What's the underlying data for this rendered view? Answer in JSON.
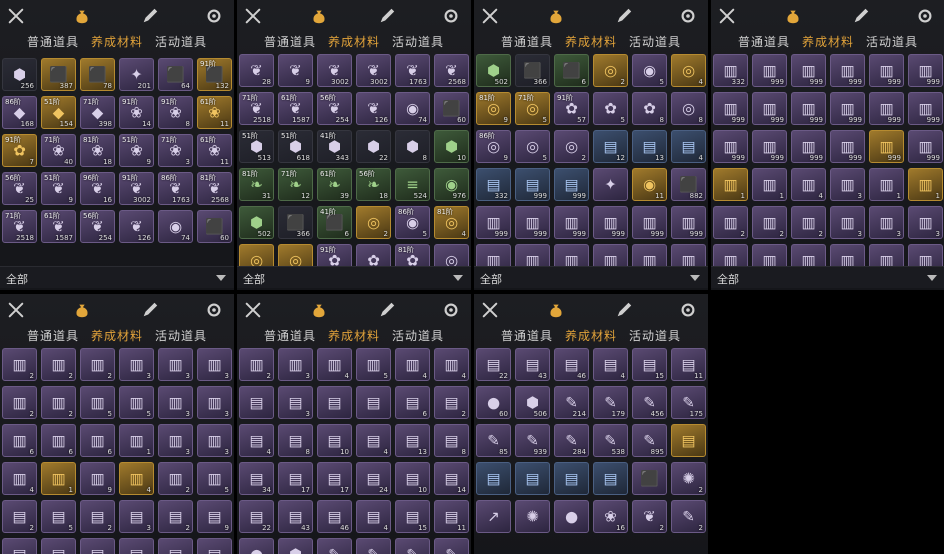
{
  "tabs": {
    "normal": "普通道具",
    "material": "养成材料",
    "event": "活动道具"
  },
  "filter": {
    "label": "全部"
  },
  "panels": [
    {
      "rows": [
        [
          "256|dark|⬢|",
          "387|gold|⬛|",
          "78|gold|⬛|",
          "201|purple|✦|",
          "64|purple|⬛|",
          "132|gold|⬛|91阶"
        ],
        [
          "168|purple|◆|86阶",
          "154|gold|◆|51阶",
          "398|purple|◆|71阶",
          "14|purple|❀|91阶",
          "8|purple|❀|91阶",
          "11|gold|❀|61阶"
        ],
        [
          "7|gold|✿|91阶",
          "40|purple|❀|71阶",
          "18|purple|❀|81阶",
          "9|purple|❀|51阶",
          "3|purple|❀|71阶",
          "11|purple|❀|61阶"
        ],
        [
          "25|purple|❦|56阶",
          "9|purple|❦|51阶",
          "16|purple|❦|96阶",
          "3002|purple|❦|91阶",
          "1763|purple|❦|86阶",
          "2568|purple|❦|81阶"
        ],
        [
          "2518|purple|❦|71阶",
          "1587|purple|❦|61阶",
          "254|purple|❦|56阶",
          "126|purple|❦|",
          "74|purple|◉|",
          "60|purple|⬛|"
        ]
      ]
    },
    {
      "rows": [
        [
          "28|purple|❦|",
          "9|purple|❦|",
          "3002|purple|❦|",
          "3002|purple|❦|",
          "1763|purple|❦|",
          "2568|purple|❦|"
        ],
        [
          "2518|purple|❦|71阶",
          "1587|purple|❦|61阶",
          "254|purple|❦|56阶",
          "126|purple|❦|",
          "74|purple|◉|",
          "60|purple|⬛|"
        ],
        [
          "513|dark|⬢|51阶",
          "618|dark|⬢|51阶",
          "343|dark|⬢|41阶",
          "22|dark|⬢|",
          "8|dark|⬢|",
          "10|green|⬢|"
        ],
        [
          "31|green|❧|81阶",
          "12|green|❧|71阶",
          "39|green|❧|61阶",
          "18|green|❧|56阶",
          "524|green|≡|",
          "976|green|◉|"
        ],
        [
          "502|green|⬢|",
          "366|dark|⬛|",
          "6|green|⬛|41阶",
          "2|gold|◎|",
          "5|purple|◉|86阶",
          "4|gold|◎|81阶"
        ],
        [
          "9|gold|◎|",
          "5|gold|◎|",
          "9|purple|✿|91阶",
          "5|purple|✿|",
          "3|purple|✿|81阶",
          "8|purple|◎|"
        ]
      ]
    },
    {
      "rows": [
        [
          "502|green|⬢|",
          "366|dark|⬛|",
          "6|green|⬛|",
          "2|gold|◎|",
          "5|purple|◉|",
          "4|gold|◎|"
        ],
        [
          "9|gold|◎|81阶",
          "5|gold|◎|71阶",
          "57|purple|✿|91阶",
          "5|purple|✿|",
          "8|purple|✿|",
          "8|purple|◎|"
        ],
        [
          "9|purple|◎|86阶",
          "5|purple|◎|",
          "2|purple|◎|",
          "12|blue|▤|",
          "13|blue|▤|",
          "4|blue|▤|"
        ],
        [
          "332|blue|▤|",
          "999|blue|▤|",
          "999|blue|▤|",
          "|purple|✦|",
          "11|gold|◉|",
          "882|purple|⬛|"
        ],
        [
          "999|purple|▥|",
          "999|purple|▥|",
          "999|purple|▥|",
          "999|purple|▥|",
          "999|purple|▥|",
          "999|purple|▥|"
        ],
        [
          "999|purple|▥|",
          "999|purple|▥|",
          "999|purple|▥|",
          "999|purple|▥|",
          "999|purple|▥|",
          "999|purple|▥|"
        ]
      ]
    },
    {
      "rows": [
        [
          "332|purple|▥|",
          "999|purple|▥|",
          "999|purple|▥|",
          "999|purple|▥|",
          "999|purple|▥|",
          "999|purple|▥|"
        ],
        [
          "999|purple|▥|",
          "999|purple|▥|",
          "999|purple|▥|",
          "999|purple|▥|",
          "999|purple|▥|",
          "999|purple|▥|"
        ],
        [
          "999|purple|▥|",
          "999|purple|▥|",
          "999|purple|▥|",
          "999|purple|▥|",
          "999|gold|▥|",
          "999|purple|▥|"
        ],
        [
          "1|gold|▥|",
          "1|purple|▥|",
          "4|purple|▥|",
          "3|purple|▥|",
          "1|purple|▥|",
          "1|gold|▥|"
        ],
        [
          "2|purple|▥|",
          "2|purple|▥|",
          "2|purple|▥|",
          "3|purple|▥|",
          "3|purple|▥|",
          "3|purple|▥|"
        ],
        [
          "3|purple|▥|",
          "6|purple|▥|",
          "5|purple|▥|",
          "1|purple|▥|",
          "6|purple|▥|",
          "2|purple|▥|"
        ]
      ]
    },
    {
      "rows": [
        [
          "2|purple|▥|",
          "2|purple|▥|",
          "2|purple|▥|",
          "3|purple|▥|",
          "3|purple|▥|",
          "3|purple|▥|"
        ],
        [
          "2|purple|▥|",
          "2|purple|▥|",
          "5|purple|▥|",
          "5|purple|▥|",
          "3|purple|▥|",
          "3|purple|▥|"
        ],
        [
          "6|purple|▥|",
          "6|purple|▥|",
          "6|purple|▥|",
          "1|purple|▥|",
          "3|purple|▥|",
          "3|purple|▥|"
        ],
        [
          "4|purple|▥|",
          "1|gold|▥|",
          "9|purple|▥|",
          "4|gold|▥|",
          "2|purple|▥|",
          "5|purple|▥|"
        ],
        [
          "2|purple|▤|",
          "5|purple|▤|",
          "2|purple|▤|",
          "3|purple|▤|",
          "2|purple|▤|",
          "9|purple|▤|"
        ],
        [
          "|purple|▤|",
          "|purple|▤|",
          "|purple|▤|",
          "|purple|▤|",
          "|purple|▤|",
          "|purple|▤|"
        ]
      ]
    },
    {
      "rows": [
        [
          "2|purple|▥|",
          "3|purple|▥|",
          "4|purple|▥|",
          "5|purple|▥|",
          "4|purple|▥|",
          "4|purple|▥|"
        ],
        [
          "|purple|▤|",
          "3|purple|▤|",
          "|purple|▤|",
          "|purple|▤|",
          "6|purple|▤|",
          "2|purple|▤|"
        ],
        [
          "4|purple|▤|",
          "8|purple|▤|",
          "10|purple|▤|",
          "4|purple|▤|",
          "13|purple|▤|",
          "8|purple|▤|"
        ],
        [
          "34|purple|▤|",
          "17|purple|▤|",
          "17|purple|▤|",
          "24|purple|▤|",
          "10|purple|▤|",
          "14|purple|▤|"
        ],
        [
          "22|purple|▤|",
          "43|purple|▤|",
          "46|purple|▤|",
          "4|purple|▤|",
          "15|purple|▤|",
          "11|purple|▤|"
        ],
        [
          "60|purple|●|",
          "506|purple|⬢|",
          "214|purple|✎|",
          "179|purple|✎|",
          "456|purple|✎|",
          "175|purple|✎|"
        ]
      ]
    },
    {
      "rows": [
        [
          "22|purple|▤|",
          "43|purple|▤|",
          "46|purple|▤|",
          "4|purple|▤|",
          "15|purple|▤|",
          "11|purple|▤|"
        ],
        [
          "60|purple|●|",
          "506|purple|⬢|",
          "214|purple|✎|",
          "179|purple|✎|",
          "456|purple|✎|",
          "175|purple|✎|"
        ],
        [
          "85|purple|✎|",
          "939|purple|✎|",
          "284|purple|✎|",
          "538|purple|✎|",
          "895|purple|✎|",
          "|gold|▤|"
        ],
        [
          "|blue|▤|",
          "|blue|▤|",
          "|blue|▤|",
          "|blue|▤|",
          "|purple|⬛|",
          "2|purple|✺|"
        ],
        [
          "|purple|↗|",
          "|purple|✺|",
          "|purple|●|",
          "16|purple|❀|",
          "2|purple|❦|",
          "2|purple|✎|"
        ]
      ]
    }
  ]
}
